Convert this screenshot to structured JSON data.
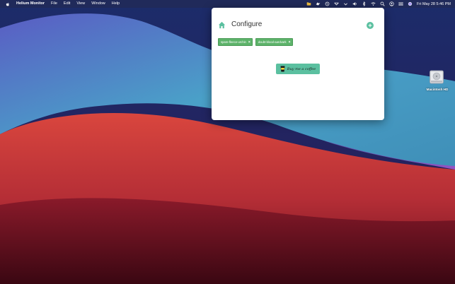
{
  "menubar": {
    "app_name": "Helium Monitor",
    "items": [
      "File",
      "Edit",
      "View",
      "Window",
      "Help"
    ],
    "status_icons": [
      "folder-icon",
      "bird-icon",
      "shazam-icon",
      "vpn-icon",
      "chevron-icon",
      "volume-icon",
      "bluetooth-icon",
      "wifi-icon",
      "search-icon",
      "user-icon",
      "control-center-icon",
      "siri-icon"
    ],
    "datetime": "Fri May 28  5:46 PM"
  },
  "popover": {
    "title": "Configure",
    "tags": [
      {
        "label": "spare-fleece-urchin"
      },
      {
        "label": "doubt-blood-aardvark"
      }
    ],
    "coffee_button": "Buy me a coffee",
    "accent_color": "#5bc0a0",
    "tag_color": "#5db36a"
  },
  "desktop": {
    "drive_label": "Macintosh HD"
  }
}
